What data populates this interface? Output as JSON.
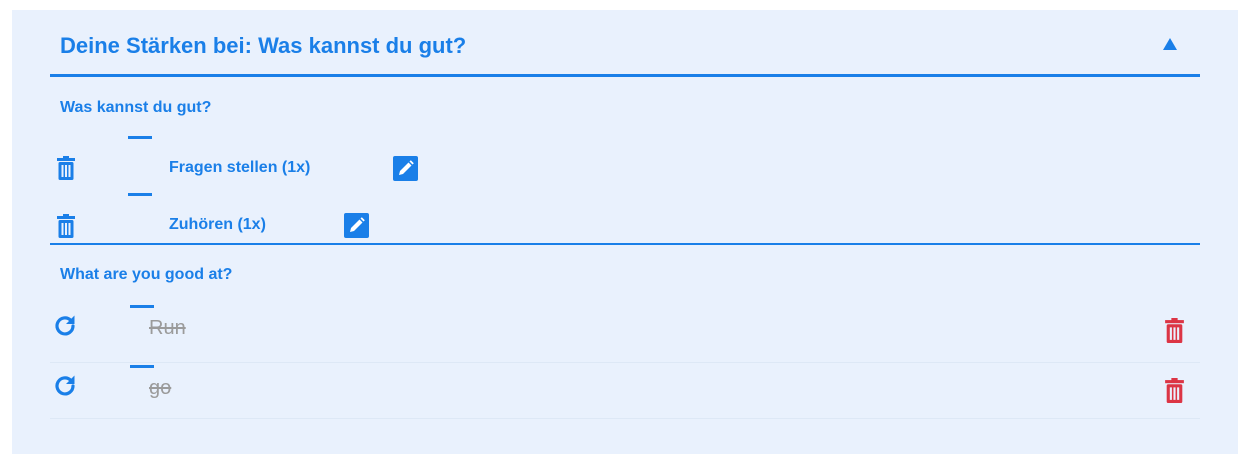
{
  "colors": {
    "accent": "#1a7fe8",
    "panel_bg": "#e9f1fd",
    "danger": "#dc3545",
    "muted_text": "#9b9b9b"
  },
  "header": {
    "title": "Deine Stärken bei: Was kannst du gut?",
    "collapse_icon": "triangle-up-icon"
  },
  "sections": [
    {
      "title": "Was kannst du gut?",
      "items": [
        {
          "label": "Fragen stellen (1x)",
          "icons": [
            "trash-icon",
            "pencil-icon"
          ]
        },
        {
          "label": "Zuhören (1x)",
          "icons": [
            "trash-icon",
            "pencil-icon"
          ]
        }
      ]
    },
    {
      "title": "What are you good at?",
      "items": [
        {
          "label": "Run",
          "struck": true,
          "icons": [
            "refresh-icon",
            "trash-icon"
          ]
        },
        {
          "label": "go",
          "struck": true,
          "icons": [
            "refresh-icon",
            "trash-icon"
          ]
        }
      ]
    }
  ]
}
